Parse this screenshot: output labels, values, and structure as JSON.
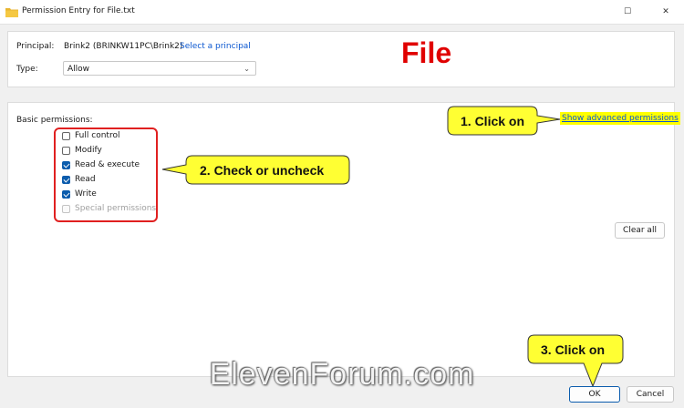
{
  "window": {
    "title": "Permission Entry for File.txt",
    "maximize_glyph": "☐",
    "close_glyph": "✕"
  },
  "principal": {
    "label": "Principal:",
    "value": "Brink2 (BRINKW11PC\\Brink2)",
    "select_link": "Select a principal"
  },
  "type": {
    "label": "Type:",
    "value": "Allow"
  },
  "heading_overlay": "File",
  "basic_permissions": {
    "label": "Basic permissions:",
    "items": [
      {
        "label": "Full control",
        "checked": false,
        "disabled": false
      },
      {
        "label": "Modify",
        "checked": false,
        "disabled": false
      },
      {
        "label": "Read & execute",
        "checked": true,
        "disabled": false
      },
      {
        "label": "Read",
        "checked": true,
        "disabled": false
      },
      {
        "label": "Write",
        "checked": true,
        "disabled": false
      },
      {
        "label": "Special permissions",
        "checked": false,
        "disabled": true
      }
    ]
  },
  "advanced_link": "Show advanced permissions",
  "clear_all_label": "Clear all",
  "buttons": {
    "ok": "OK",
    "cancel": "Cancel"
  },
  "callouts": {
    "step1": "1. Click on",
    "step2": "2. Check or uncheck",
    "step3": "3. Click on"
  },
  "watermark": "ElevenForum.com",
  "colors": {
    "callout_fill": "#ffff33",
    "callout_stroke": "#333333",
    "highlight_red": "#e02020",
    "accent_blue": "#0b5cad"
  }
}
